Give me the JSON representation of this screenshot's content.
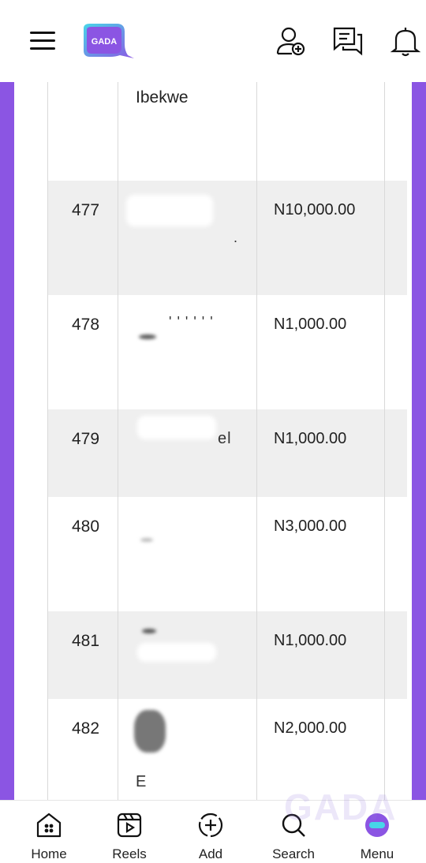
{
  "header": {
    "logo_text": "GADA",
    "icons": [
      "menu-icon",
      "add-user-icon",
      "messages-icon",
      "bell-icon"
    ]
  },
  "table": {
    "partial_row_name": "Ibekwe",
    "rows": [
      {
        "num": "477",
        "amount": "N10,000.00",
        "name_fragment": "."
      },
      {
        "num": "478",
        "amount": "N1,000.00",
        "name_fragment": "' ' ' ' ' '"
      },
      {
        "num": "479",
        "amount": "N1,000.00",
        "name_fragment": "el"
      },
      {
        "num": "480",
        "amount": "N3,000.00",
        "name_fragment": ""
      },
      {
        "num": "481",
        "amount": "N1,000.00",
        "name_fragment": ""
      },
      {
        "num": "482",
        "amount": "N2,000.00",
        "name_fragment": "E"
      }
    ]
  },
  "bottom_nav": {
    "items": [
      {
        "label": "Home",
        "icon": "home-icon"
      },
      {
        "label": "Reels",
        "icon": "reels-icon"
      },
      {
        "label": "Add",
        "icon": "add-icon"
      },
      {
        "label": "Search",
        "icon": "search-icon"
      },
      {
        "label": "Menu",
        "icon": "menu-avatar-icon"
      }
    ]
  },
  "colors": {
    "accent": "#8b55e3",
    "row_shade": "#efefef",
    "border": "#d9d9d9"
  }
}
